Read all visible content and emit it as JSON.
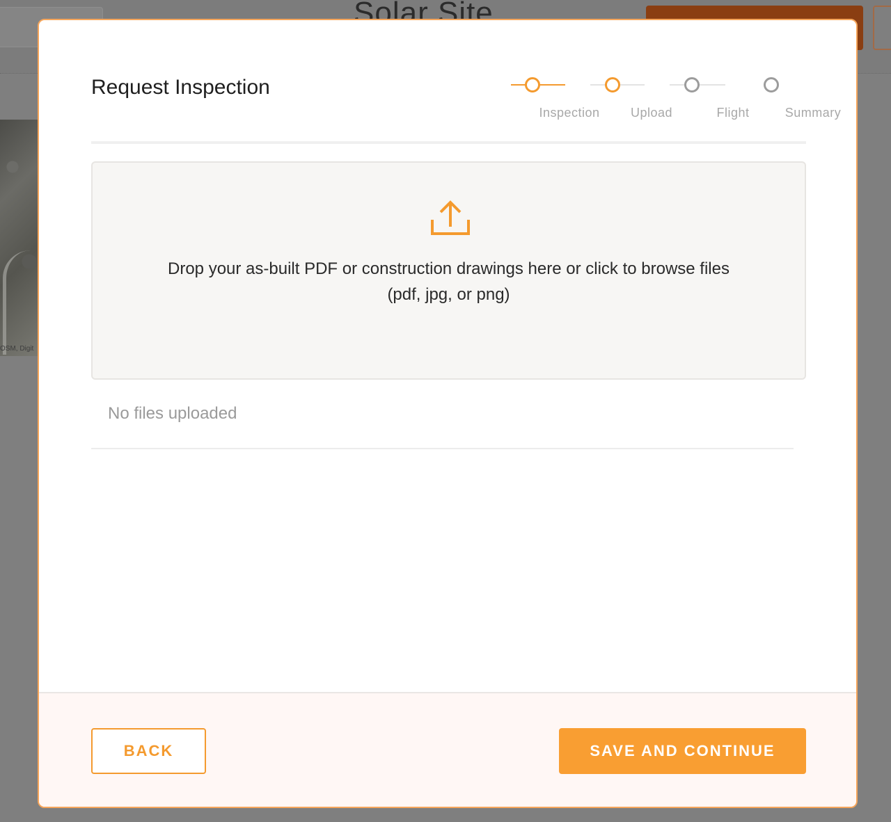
{
  "background": {
    "title": "Solar Site",
    "map_credit": "OSM, Digit"
  },
  "modal": {
    "title": "Request Inspection",
    "stepper": {
      "steps": [
        {
          "label": "Inspection",
          "state": "complete"
        },
        {
          "label": "Upload",
          "state": "current"
        },
        {
          "label": "Flight",
          "state": "pending"
        },
        {
          "label": "Summary",
          "state": "pending"
        }
      ]
    },
    "dropzone": {
      "icon": "upload-icon",
      "line1": "Drop your as-built PDF or construction drawings here or click to browse files",
      "line2": "(pdf, jpg, or png)"
    },
    "files_status": "No files uploaded",
    "footer": {
      "back_label": "BACK",
      "save_label": "SAVE AND CONTINUE"
    }
  },
  "colors": {
    "accent": "#f49a2e",
    "primary_button": "#f99e32",
    "inactive_step": "#9c9c9c",
    "footer_bg": "#fff7f5"
  }
}
